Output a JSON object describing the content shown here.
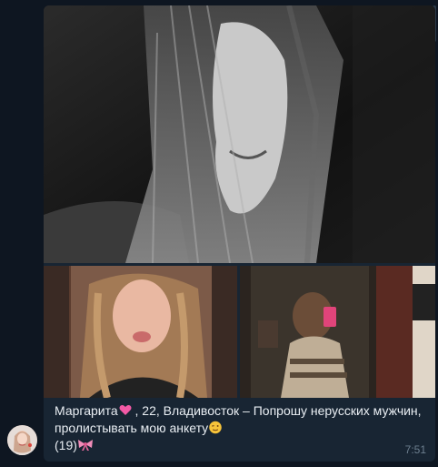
{
  "message": {
    "caption_line1_a": "Маргарита",
    "caption_line1_b": " , 22, Владивосток – Попрошу нерусских мужчин,",
    "caption_line2": "пролистывать мою анкету",
    "caption_line3": "(19)",
    "time": "7:51",
    "icons": {
      "heart": "pink-heart-icon",
      "wink": "winking-face-icon",
      "bow": "ribbon-bow-icon"
    }
  },
  "colors": {
    "background": "#0e1621",
    "bubble": "#182533",
    "text": "#e9eef3",
    "time": "#6d7f8f",
    "heart": "#f25aa6"
  }
}
